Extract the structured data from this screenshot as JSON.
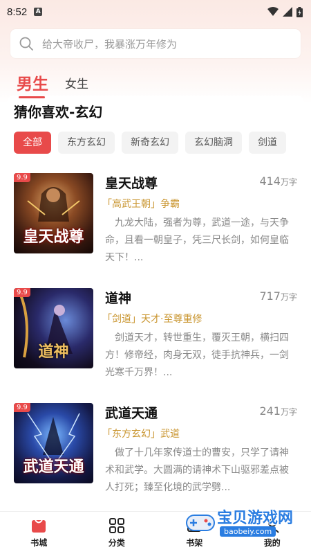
{
  "status": {
    "time": "8:52",
    "indicator": "A"
  },
  "search": {
    "placeholder": "给大帝收尸，我暴涨万年修为"
  },
  "gender_tabs": {
    "male": "男生",
    "female": "女生"
  },
  "section_title": "猜你喜欢-玄幻",
  "chips": [
    "全部",
    "东方玄幻",
    "新奇玄幻",
    "玄幻脑洞",
    "剑道"
  ],
  "books": [
    {
      "title": "皇天战尊",
      "count": "414",
      "unit": "万字",
      "tags": "「高武王朝」争霸",
      "desc": "九龙大陆，强者为尊，武道一途，与天争命，且看一朝皇子，凭三尺长剑，如何皇临天下！...",
      "badge": "9.9",
      "cover_text": "皇天战尊"
    },
    {
      "title": "道神",
      "count": "717",
      "unit": "万字",
      "tags": "「剑道」天才·至尊重修",
      "desc": "剑道天才，转世重生，覆灭王朝，横扫四方！修帝经，肉身无双，徒手抗神兵，一剑光寒千万界！...",
      "badge": "9.9",
      "cover_text": "道神"
    },
    {
      "title": "武道天通",
      "count": "241",
      "unit": "万字",
      "tags": "「东方玄幻」武道",
      "desc": "做了十几年家传道士的曹安，只学了请神术和武学。大圆满的请神术下山驱邪差点被人打死；臻至化境的武学劈...",
      "badge": "9.9",
      "cover_text": "武道天通"
    }
  ],
  "bottom_nav": [
    "书城",
    "分类",
    "书架",
    "我的"
  ],
  "watermark": {
    "text": "宝贝游戏网",
    "url": "baobeiy.com"
  },
  "colors": {
    "accent": "#e84a4a",
    "tag": "#c9952f"
  }
}
